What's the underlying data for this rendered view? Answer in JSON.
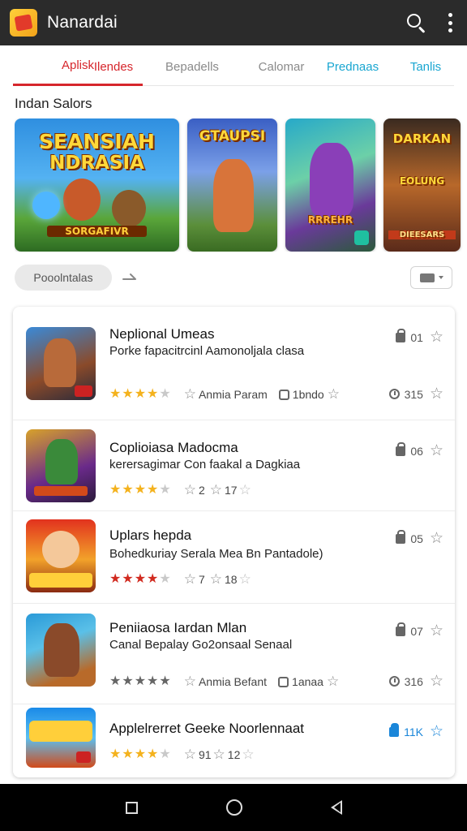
{
  "app": {
    "title": "Nanardai",
    "logo_icon": "app-logo-icon"
  },
  "tabs": [
    {
      "label": "Aplisk",
      "active": true
    },
    {
      "label": "Ilendes"
    },
    {
      "label": "Bepadells"
    },
    {
      "label": "Calomar"
    },
    {
      "label": "Prednaas"
    },
    {
      "label": "Tanlis"
    }
  ],
  "featured": {
    "title": "Indan Salors",
    "banners": [
      {
        "title_line1": "SEANSIAH",
        "title_line2": "NDRASIA",
        "caption": "SORGAFIVR"
      },
      {
        "title_line1": "GTAUPSI",
        "caption": ""
      },
      {
        "title_line1": "",
        "caption": "RRREHR"
      },
      {
        "title_line1": "DARKAN",
        "title_line2": "EOLUNG",
        "caption": "DIEESARS"
      }
    ]
  },
  "filter": {
    "chip_label": "Pooolntalas"
  },
  "apps": [
    {
      "name": "Neplional Umeas",
      "description": "Porke fapacitrcinl Aamonoljala clasa",
      "rating": 4,
      "meta1": "Anmia Param",
      "meta2": "1bndo",
      "top_right": "01",
      "bottom_right": "315"
    },
    {
      "name": "Coplioiasa Madocma",
      "description": "kerersagimar Con faakal a Dagkiaa",
      "rating": 4,
      "meta1": "2",
      "meta2": "17",
      "top_right": "06"
    },
    {
      "name": "Uplars hepda",
      "description": "Bohedkuriay Serala Mea  Bn Pantadole)",
      "rating": 4,
      "meta1": "7",
      "meta2": "18",
      "top_right": "05"
    },
    {
      "name": "Peniiaosa Iardan Mlan",
      "description": "Canal Bepalay Go2onsaal Senaal",
      "rating": 5,
      "meta1": "Anmia Befant",
      "meta2": "1anaa",
      "top_right": "07",
      "bottom_right": "316"
    },
    {
      "name": "Applelrerret Geeke Noorlennaat",
      "description": "",
      "rating": 4,
      "meta1": "91",
      "meta2": "12",
      "top_right": "11K"
    }
  ],
  "colors": {
    "accent": "#d6262c",
    "cyan": "#19a6d1",
    "star": "#f4b21d",
    "topbar": "#2b2b2b"
  }
}
